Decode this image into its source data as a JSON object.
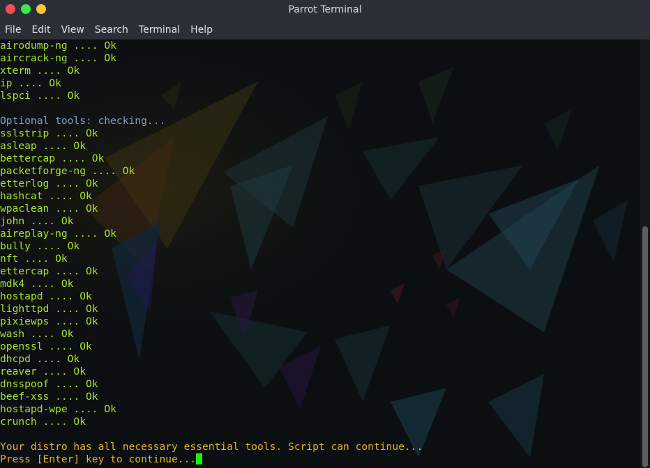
{
  "window": {
    "title": "Parrot Terminal"
  },
  "titlebar": {
    "buttons": [
      {
        "name": "close",
        "color": "#f25056"
      },
      {
        "name": "maximize",
        "color": "#39ea49"
      },
      {
        "name": "minimize",
        "color": "#fac536"
      }
    ]
  },
  "menu": {
    "file": "File",
    "edit": "Edit",
    "view": "View",
    "search": "Search",
    "terminal": "Terminal",
    "help": "Help"
  },
  "colors": {
    "ok_line": "#a6e22e",
    "header_line": "#7f9fd0",
    "status_line": "#e6b422",
    "cursor": "#1bef00"
  },
  "terminal": {
    "lines": [
      {
        "text": "airodump-ng .... Ok",
        "style": "ok"
      },
      {
        "text": "aircrack-ng .... Ok",
        "style": "ok"
      },
      {
        "text": "xterm .... Ok",
        "style": "ok"
      },
      {
        "text": "ip .... Ok",
        "style": "ok"
      },
      {
        "text": "lspci .... Ok",
        "style": "ok"
      },
      {
        "text": "",
        "style": "blank"
      },
      {
        "text": "Optional tools: checking...",
        "style": "header"
      },
      {
        "text": "sslstrip .... Ok",
        "style": "ok"
      },
      {
        "text": "asleap .... Ok",
        "style": "ok"
      },
      {
        "text": "bettercap .... Ok",
        "style": "ok"
      },
      {
        "text": "packetforge-ng .... Ok",
        "style": "ok"
      },
      {
        "text": "etterlog .... Ok",
        "style": "ok"
      },
      {
        "text": "hashcat .... Ok",
        "style": "ok"
      },
      {
        "text": "wpaclean .... Ok",
        "style": "ok"
      },
      {
        "text": "john .... Ok",
        "style": "ok"
      },
      {
        "text": "aireplay-ng .... Ok",
        "style": "ok"
      },
      {
        "text": "bully .... Ok",
        "style": "ok"
      },
      {
        "text": "nft .... Ok",
        "style": "ok"
      },
      {
        "text": "ettercap .... Ok",
        "style": "ok"
      },
      {
        "text": "mdk4 .... Ok",
        "style": "ok"
      },
      {
        "text": "hostapd .... Ok",
        "style": "ok"
      },
      {
        "text": "lighttpd .... Ok",
        "style": "ok"
      },
      {
        "text": "pixiewps .... Ok",
        "style": "ok"
      },
      {
        "text": "wash .... Ok",
        "style": "ok"
      },
      {
        "text": "openssl .... Ok",
        "style": "ok"
      },
      {
        "text": "dhcpd .... Ok",
        "style": "ok"
      },
      {
        "text": "reaver .... Ok",
        "style": "ok"
      },
      {
        "text": "dnsspoof .... Ok",
        "style": "ok"
      },
      {
        "text": "beef-xss .... Ok",
        "style": "ok"
      },
      {
        "text": "hostapd-wpe .... Ok",
        "style": "ok"
      },
      {
        "text": "crunch .... Ok",
        "style": "ok"
      },
      {
        "text": "",
        "style": "blank"
      },
      {
        "text": "Your distro has all necessary essential tools. Script can continue...",
        "style": "status"
      },
      {
        "text": "Press [Enter] key to continue...",
        "style": "status",
        "cursor": true
      }
    ]
  }
}
